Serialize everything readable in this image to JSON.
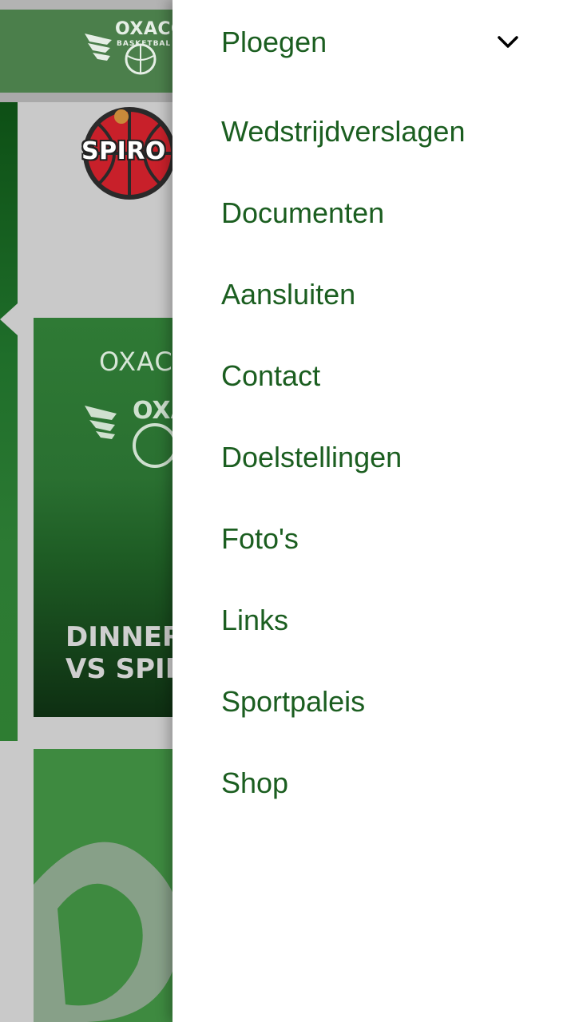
{
  "background": {
    "header_logo_text": "OXACO",
    "header_logo_subtext": "BASKETBAL",
    "team_logo_text": "SPIRO",
    "card1": {
      "top_text": "OXACO",
      "title_line1": "DINNER",
      "title_line2": "VS SPIR"
    }
  },
  "drawer": {
    "items": [
      {
        "label": "Ploegen",
        "has_submenu": true
      },
      {
        "label": "Wedstrijdverslagen"
      },
      {
        "label": "Documenten"
      },
      {
        "label": "Aansluiten"
      },
      {
        "label": "Contact"
      },
      {
        "label": "Doelstellingen"
      },
      {
        "label": "Foto's"
      },
      {
        "label": "Links"
      },
      {
        "label": "Sportpaleis"
      },
      {
        "label": "Shop"
      }
    ],
    "chevron_icon": "chevron-down-icon"
  },
  "colors": {
    "menu_text": "#1b5e20",
    "brand_green": "#2e7d32",
    "drawer_bg": "#ffffff"
  }
}
